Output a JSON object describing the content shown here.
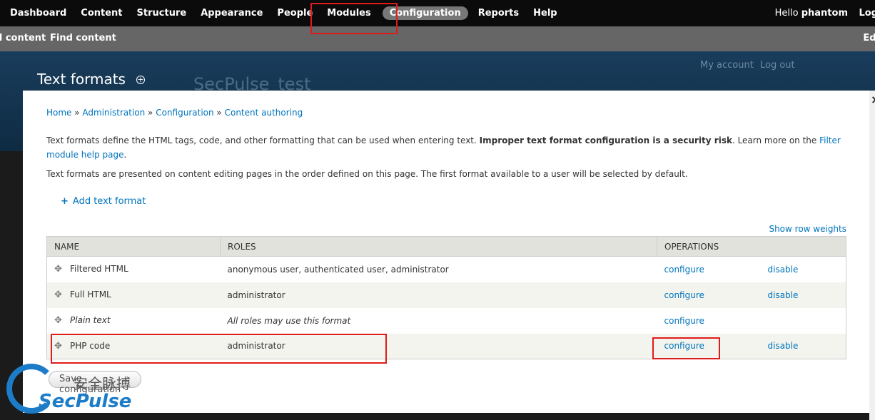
{
  "toolbar": {
    "menu": [
      "Dashboard",
      "Content",
      "Structure",
      "Appearance",
      "People",
      "Modules",
      "Configuration",
      "Reports",
      "Help"
    ],
    "active": "Configuration",
    "hello_prefix": "Hello ",
    "username": "phantom",
    "logout_cut": "Log"
  },
  "shortcuts": {
    "add_content_cut": "d content",
    "find_content": "Find content",
    "edit_cut": "Edi"
  },
  "header": {
    "page_title": "Text formats",
    "site_name": "SecPulse_test",
    "my_account": "My account",
    "log_out": "Log out"
  },
  "breadcrumb": {
    "home": "Home",
    "administration": "Administration",
    "configuration": "Configuration",
    "content_authoring": "Content authoring",
    "sep": " » "
  },
  "intro": {
    "p1_a": "Text formats define the HTML tags, code, and other formatting that can be used when entering text. ",
    "p1_bold": "Improper text format configuration is a security risk",
    "p1_b": ". Learn more on the ",
    "p1_link": "Filter module help page",
    "p1_c": ".",
    "p2": "Text formats are presented on content editing pages in the order defined on this page. The first format available to a user will be selected by default."
  },
  "add_format": "Add text format",
  "show_weights": "Show row weights",
  "table": {
    "headers": [
      "Name",
      "Roles",
      "Operations"
    ],
    "rows": [
      {
        "name": "Filtered HTML",
        "roles": "anonymous user, authenticated user, administrator",
        "configure": "configure",
        "disable": "disable"
      },
      {
        "name": "Full HTML",
        "roles": "administrator",
        "configure": "configure",
        "disable": "disable"
      },
      {
        "name": "Plain text",
        "roles": "All roles may use this format",
        "configure": "configure",
        "disable": ""
      },
      {
        "name": "PHP code",
        "roles": "administrator",
        "configure": "configure",
        "disable": "disable"
      }
    ]
  },
  "save_button": "Save configuration",
  "watermark": {
    "cn": "安全脉搏",
    "en": "SecPulse"
  },
  "colors": {
    "link": "#0074bd",
    "toolbar_bg": "#0b0b0b",
    "annotation_red": "#e01b1b"
  }
}
